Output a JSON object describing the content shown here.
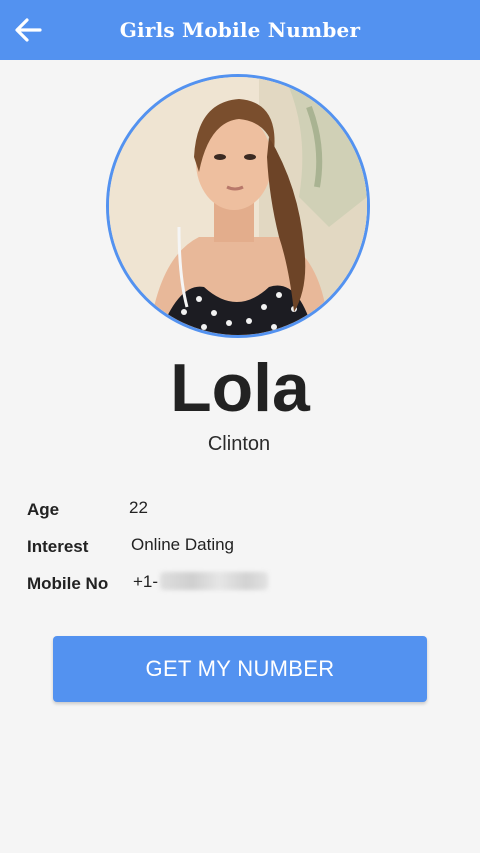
{
  "app_bar": {
    "title": "Girls Mobile Number",
    "back_icon": "arrow-left-icon",
    "color": "#5392f0"
  },
  "profile": {
    "photo": "profile-photo",
    "name": "Lola",
    "city": "Clinton"
  },
  "details": {
    "age_label": "Age",
    "age_value": "22",
    "interest_label": "Interest",
    "interest_value": "Online Dating",
    "mobile_label": "Mobile No",
    "mobile_prefix": "+1-"
  },
  "cta": {
    "label": "GET MY NUMBER"
  }
}
